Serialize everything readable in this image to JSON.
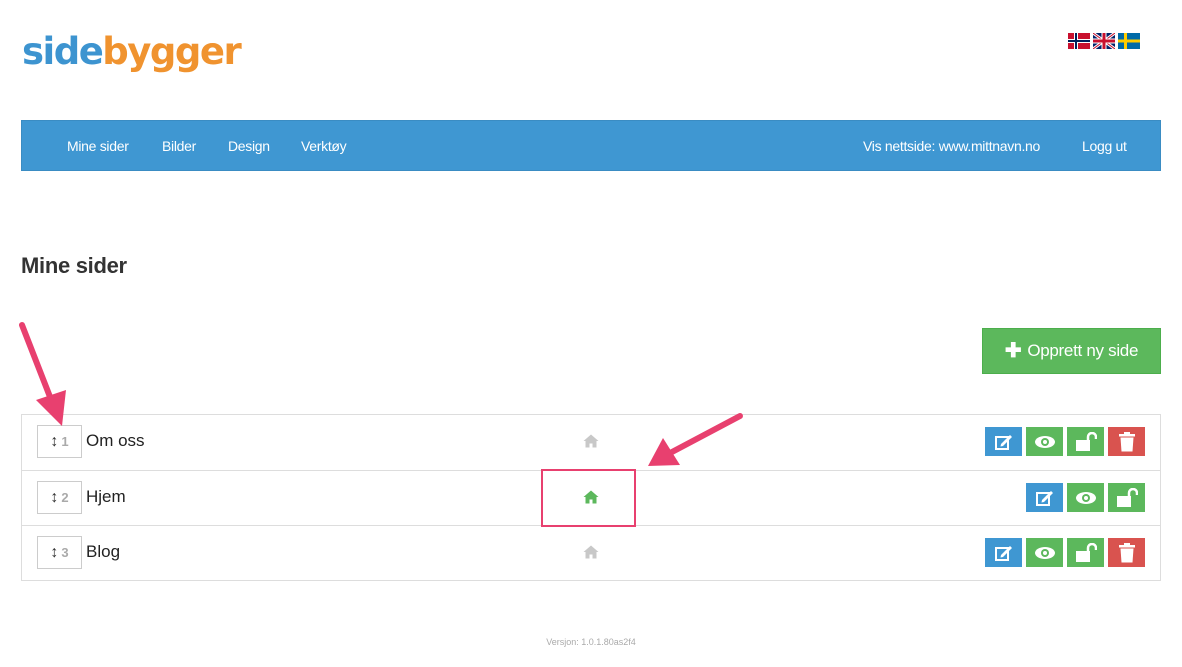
{
  "logo": {
    "part1": "side",
    "part2": "bygger"
  },
  "languages": [
    {
      "code": "no",
      "icon": "norway-flag-icon"
    },
    {
      "code": "en",
      "icon": "uk-flag-icon"
    },
    {
      "code": "sv",
      "icon": "sweden-flag-icon"
    }
  ],
  "nav": {
    "left": [
      "Mine sider",
      "Bilder",
      "Design",
      "Verktøy"
    ],
    "view_site": "Vis nettside: www.mittnavn.no",
    "logout": "Logg ut",
    "bg_color": "#3f97d2"
  },
  "page_title": "Mine sider",
  "create_button": {
    "label": "Opprett ny side",
    "icon": "plus-icon",
    "color": "#5cb85c"
  },
  "pages": [
    {
      "order": "1",
      "name": "Om oss",
      "is_home": false,
      "actions": [
        "edit",
        "view",
        "unlock",
        "delete"
      ]
    },
    {
      "order": "2",
      "name": "Hjem",
      "is_home": true,
      "actions": [
        "edit",
        "view",
        "unlock"
      ]
    },
    {
      "order": "3",
      "name": "Blog",
      "is_home": false,
      "actions": [
        "edit",
        "view",
        "unlock",
        "delete"
      ]
    }
  ],
  "icons": {
    "handle": "sort-arrows-icon",
    "home_active_color": "#5cb85c",
    "home_inactive_color": "#c8c8c8"
  },
  "action_colors": {
    "edit": "#3f97d2",
    "view": "#5cb85c",
    "unlock": "#5cb85c",
    "delete": "#d9534f"
  },
  "annotation_color": "#e8406f",
  "version": "Versjon: 1.0.1.80as2f4"
}
